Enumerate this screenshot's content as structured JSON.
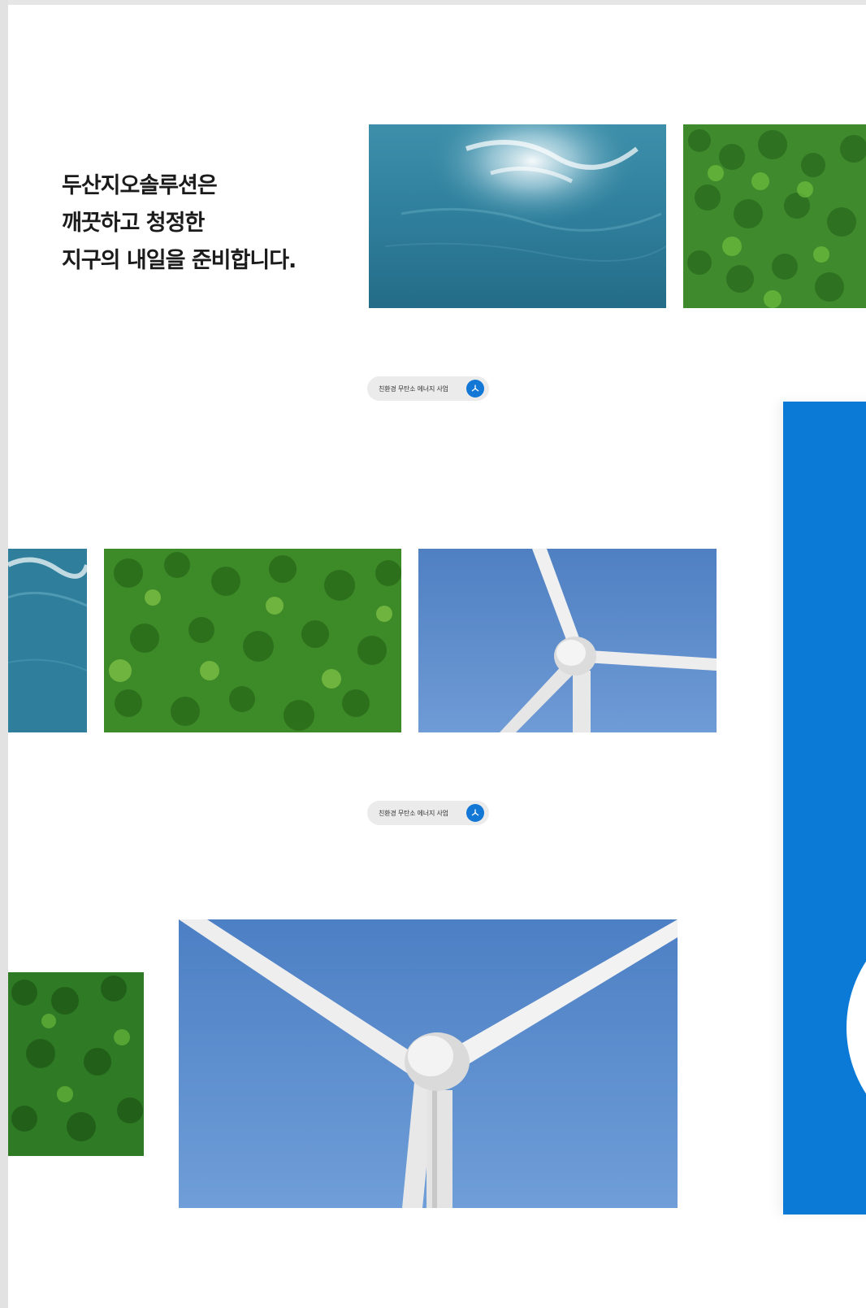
{
  "hero": {
    "line1": "두산지오솔루션은",
    "line2": "깨끗하고 청정한",
    "line3": "지구의 내일을 준비합니다."
  },
  "pills": [
    {
      "label": "친환경 무탄소 에너지 사업",
      "icon": "fan-icon"
    },
    {
      "label": "친환경 무탄소 에너지 사업",
      "icon": "fan-icon"
    }
  ],
  "colors": {
    "accent_blue": "#0a7ad6",
    "water": "#2f7d99",
    "forest": "#3f8a2c",
    "sky": "#5a88c8"
  }
}
